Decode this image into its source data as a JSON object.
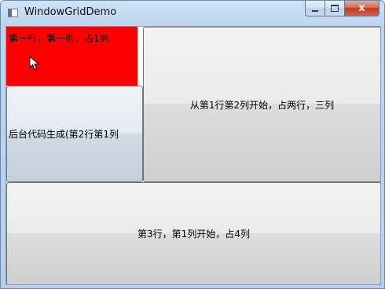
{
  "window": {
    "title": "WindowGridDemo",
    "caption": {
      "close_label": "x"
    }
  },
  "grid": {
    "red_cell_text": "第一行，第一列，占1列",
    "button_r2c1_text": "后台代码生成(第2行第1列",
    "button_big_text": "从第1行第2列开始，占两行，三列",
    "button_bottom_text": "第3行，第1列开始，占4列"
  },
  "colors": {
    "red_cell": "#ff0000"
  },
  "icons": {
    "app": "window-icon",
    "cursor": "mouse-pointer-icon"
  }
}
